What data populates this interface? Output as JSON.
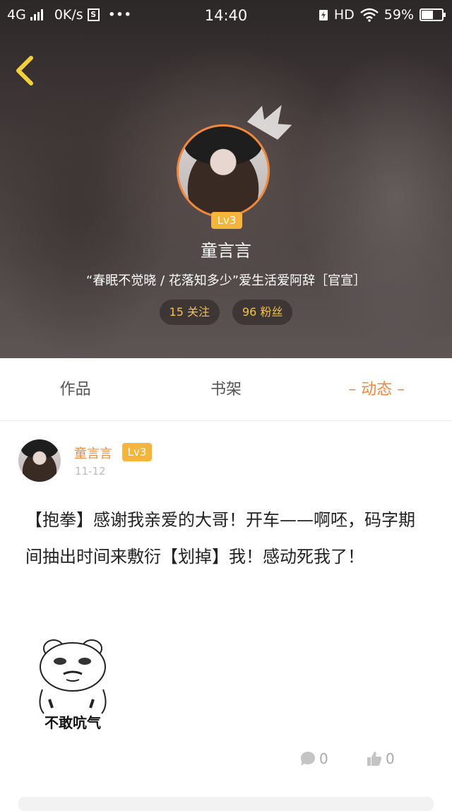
{
  "status_bar": {
    "network": "4G",
    "speed": "0K/s",
    "s_icon_letter": "S",
    "more": "•••",
    "time": "14:40",
    "hd": "HD",
    "battery": "59%"
  },
  "profile": {
    "name": "童言言",
    "level": "Lv3",
    "bio": "“春眠不觉晓 / 花落知多少”爱生活爱阿辞［官宣］",
    "following": "15 关注",
    "followers": "96 粉丝"
  },
  "tabs": [
    {
      "label": "作品"
    },
    {
      "label": "书架"
    },
    {
      "label": "– 动态 –"
    }
  ],
  "post": {
    "author": "童言言",
    "level": "Lv3",
    "date": "11-12",
    "text": "【抱拳】感谢我亲爱的大哥！开车——啊呸，码字期间抽出时间来敷衍【划掉】我！感动死我了！",
    "meme_caption": "不敢吭气",
    "comments": "0",
    "likes": "0"
  },
  "colors": {
    "accent": "#f0893b",
    "badge": "#f4b53a",
    "stat_text": "#f5c141",
    "back_arrow": "#f2d13b"
  },
  "icons": {
    "back": "chevron-left-icon",
    "crown": "crown-icon",
    "comment": "comment-bubble-icon",
    "like": "thumbs-up-icon"
  }
}
